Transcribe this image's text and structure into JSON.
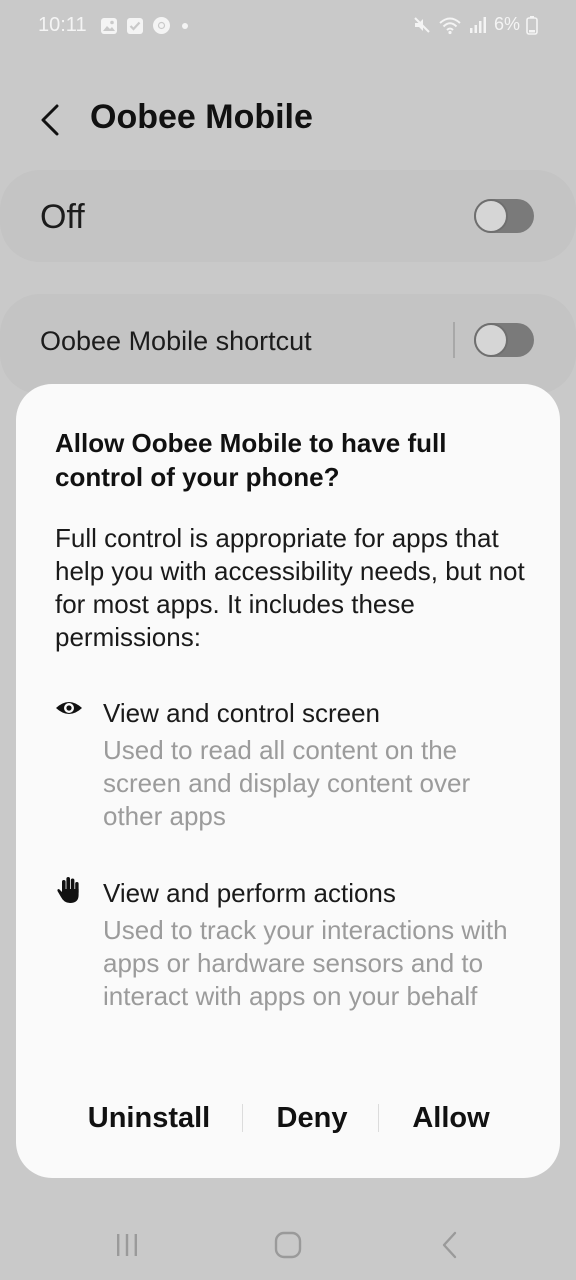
{
  "status_bar": {
    "time": "10:11",
    "battery": "6%",
    "left_icons": [
      "gallery-icon",
      "check-icon",
      "chrome-icon",
      "dot-icon"
    ],
    "right_icons": [
      "mute-icon",
      "wifi-icon",
      "signal-icon",
      "battery-icon"
    ]
  },
  "header": {
    "title": "Oobee Mobile"
  },
  "settings": {
    "main_toggle_label": "Off",
    "main_toggle_state": false,
    "shortcut_label": "Oobee Mobile shortcut",
    "shortcut_toggle_state": false
  },
  "dialog": {
    "title": "Allow Oobee Mobile to have full control of your phone?",
    "body": "Full control is appropriate for apps that help you with accessibility needs, but not for most apps. It includes these permissions:",
    "permissions": [
      {
        "icon": "eye-icon",
        "title": "View and control screen",
        "description": "Used to read all content on the screen and display content over other apps"
      },
      {
        "icon": "hand-icon",
        "title": "View and perform actions",
        "description": "Used to track your interactions with apps or hardware sensors and to interact with apps on your behalf"
      }
    ],
    "actions": {
      "uninstall": "Uninstall",
      "deny": "Deny",
      "allow": "Allow"
    }
  },
  "nav_bar": {
    "buttons": [
      "recents-icon",
      "home-icon",
      "back-icon"
    ]
  }
}
